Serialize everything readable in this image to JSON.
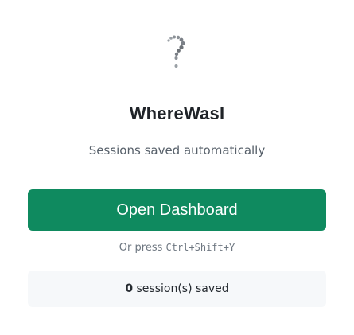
{
  "header": {
    "logo_icon": "question-mark-trail-icon",
    "app_name": "WhereWasI",
    "subtitle": "Sessions saved automatically"
  },
  "actions": {
    "open_dashboard_label": "Open Dashboard"
  },
  "shortcut": {
    "prefix": "Or press ",
    "keys": "Ctrl+Shift+Y"
  },
  "status": {
    "session_count": "0",
    "session_suffix": " session(s) saved"
  },
  "colors": {
    "primary_button": "#0f8a5f",
    "stat_background": "#f6f8fa",
    "title_text": "#1f2328",
    "muted_text": "#6e7781"
  }
}
